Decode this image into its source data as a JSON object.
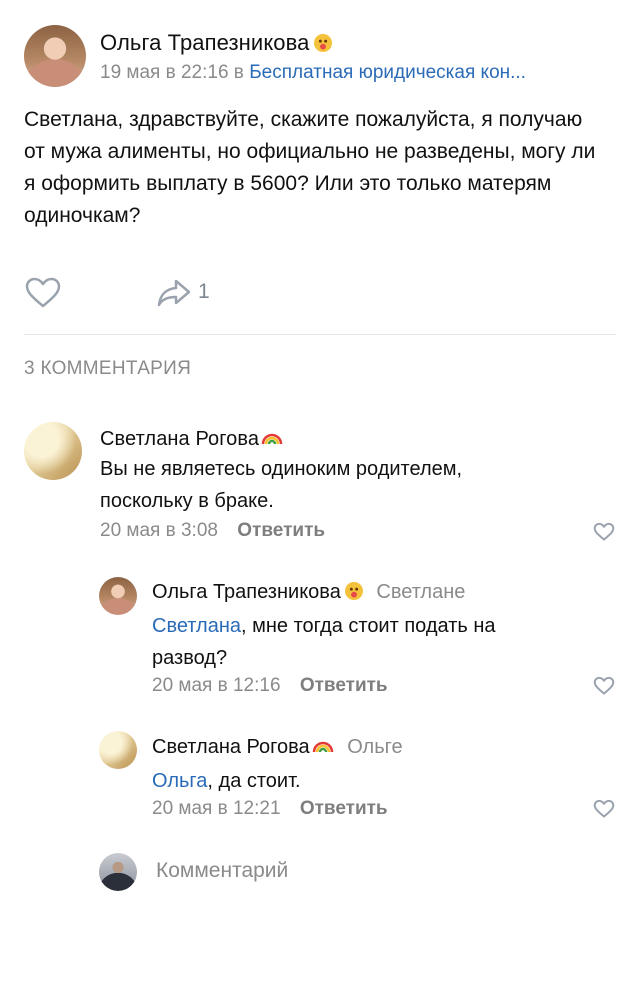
{
  "post": {
    "author": "Ольга Трапезникова",
    "emoji_icon": "tongue-face-emoji",
    "date": "19 мая в 22:16 в",
    "group": "Бесплатная юридическая кон...",
    "text": "Светлана, здравствуйте,  скажите пожалуйста, я получаю от мужа алименты,  но официально не разведены, могу ли я оформить выплату в 5600? Или это только матерям одиночкам?",
    "share_count": "1"
  },
  "comments_header": "3 КОММЕНТАРИЯ",
  "comments": [
    {
      "author": "Светлана Рогова",
      "text": "Вы не являетесь одиноким родителем, поскольку в браке.",
      "date": "20 мая в 3:08",
      "reply_label": "Ответить"
    },
    {
      "author": "Ольга Трапезникова",
      "reply_to": "Светлане",
      "mention": "Светлана",
      "text": ", мне тогда стоит  подать на развод?",
      "date": "20 мая в 12:16",
      "reply_label": "Ответить"
    },
    {
      "author": "Светлана Рогова",
      "reply_to": "Ольге",
      "mention": "Ольга",
      "text": ", да стоит.",
      "date": "20 мая в 12:21",
      "reply_label": "Ответить"
    }
  ],
  "composer": {
    "placeholder": "Комментарий"
  },
  "colors": {
    "link": "#2a6bb8",
    "meta": "#8a8a8a",
    "icon": "#9aa3ad"
  }
}
